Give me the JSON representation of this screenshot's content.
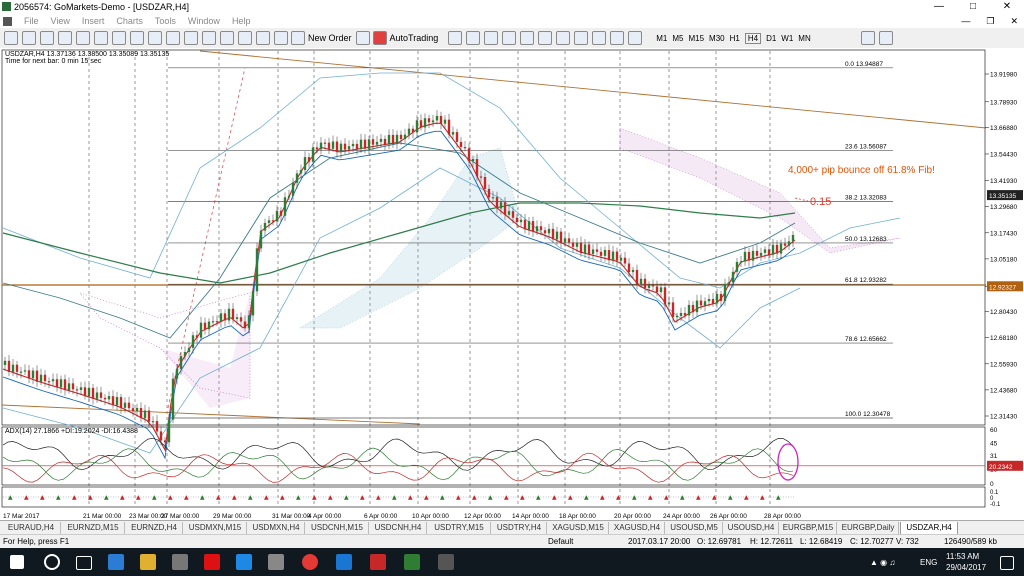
{
  "window": {
    "title": "2056574: GoMarkets-Demo - [USDZAR,H4]"
  },
  "menu": [
    "File",
    "View",
    "Insert",
    "Charts",
    "Tools",
    "Window",
    "Help"
  ],
  "toolbar": {
    "new_order": "New Order",
    "autotrading": "AutoTrading",
    "timeframes": [
      "M1",
      "M5",
      "M15",
      "M30",
      "H1",
      "H4",
      "D1",
      "W1",
      "MN"
    ]
  },
  "chart": {
    "info_line": "USDZAR,H4  13.37136 13.38500 13.35089 13.35135",
    "timer": "Time for next bar: 0 min 15 sec",
    "price_ticks": [
      "13.91980",
      "13.78930",
      "13.66880",
      "13.54430",
      "13.41930",
      "13.29680",
      "13.17430",
      "13.05180",
      "12.92327",
      "12.80430",
      "12.68180",
      "12.55930",
      "12.43680",
      "12.31430"
    ],
    "current_price": "13.35135",
    "hline_price": "12.92327",
    "fib_levels": [
      {
        "label": "0.0  13.94887"
      },
      {
        "label": "23.6  13.56087"
      },
      {
        "label": "38.2  13.32083"
      },
      {
        "label": "50.0  13.12683"
      },
      {
        "label": "61.8  12.93282"
      },
      {
        "label": "78.6  12.65662"
      },
      {
        "label": "100.0  12.30478"
      }
    ],
    "annotation": "4,000+ pip bounce off 61.8% Fib!",
    "annotation_value": "0.15",
    "date_ticks": [
      "17 Mar 2017",
      "21 Mar 00:00",
      "23 Mar 00:00",
      "27 Mar 00:00",
      "29 Mar 00:00",
      "31 Mar 00:00",
      "4 Apr 00:00",
      "6 Apr 00:00",
      "10 Apr 00:00",
      "12 Apr 00:00",
      "14 Apr 00:00",
      "18 Apr 00:00",
      "20 Apr 00:00",
      "24 Apr 00:00",
      "26 Apr 00:00",
      "28 Apr 00:00"
    ],
    "adx_label": "ADX(14) 27.1866 +DI:19.2024 -DI:16.4388",
    "adx_ticks": [
      "60",
      "45",
      "31",
      "16",
      "0"
    ],
    "adx_current": "20.2342",
    "ind3_ticks": [
      "0.1",
      "0",
      "-0.1"
    ],
    "colors": {
      "bull": "#2e7d32",
      "bear": "#c62828",
      "fib": "#555555",
      "annotation": "#e65100",
      "cloud_bear": "#c060c0",
      "cloud_bull": "#60a8c8"
    }
  },
  "tabs": [
    "EURAUD,H4",
    "EURNZD,M15",
    "EURNZD,H4",
    "USDMXN,M15",
    "USDMXN,H4",
    "USDCNH,M15",
    "USDCNH,H4",
    "USDTRY,M15",
    "USDTRY,H4",
    "XAGUSD,M15",
    "XAGUSD,H4",
    "USOUSD,M5",
    "USOUSD,H4",
    "EURGBP,M15",
    "EURGBP,Daily",
    "USDZAR,H4"
  ],
  "status": {
    "help": "For Help, press F1",
    "profile": "Default",
    "datetime": "2017.03.17 20:00",
    "open": "O: 12.69781",
    "high": "H: 12.72611",
    "low": "L: 12.68419",
    "close": "C: 12.70277",
    "volume": "V: 732",
    "traffic": "126490/589 kb"
  },
  "taskbar": {
    "time": "11:53 AM",
    "date": "29/04/2017",
    "lang": "ENG"
  }
}
